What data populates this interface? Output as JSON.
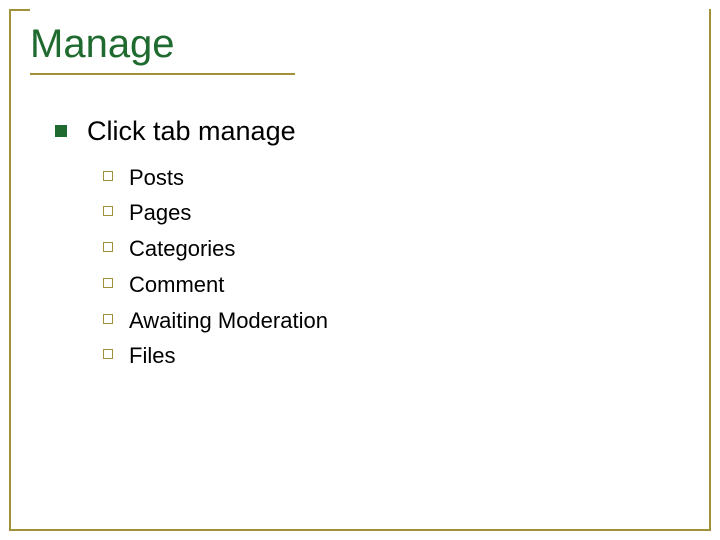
{
  "title": "Manage",
  "heading": "Click tab manage",
  "items": {
    "i0": "Posts",
    "i1": "Pages",
    "i2": "Categories",
    "i3": "Comment",
    "i4": "Awaiting Moderation",
    "i5": "Files"
  }
}
